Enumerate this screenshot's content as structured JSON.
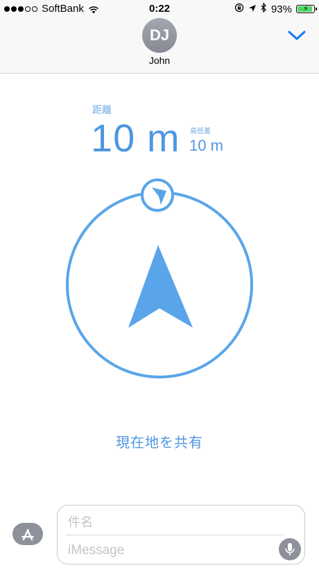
{
  "status_bar": {
    "carrier": "SoftBank",
    "signal_bars_filled": 3,
    "signal_bars_total": 5,
    "time": "0:22",
    "battery_percent": "93%",
    "battery_level": 0.93,
    "icons": [
      "wifi-icon",
      "rotation-lock-icon",
      "location-arrow-icon",
      "bluetooth-icon",
      "battery-icon",
      "charging-bolt-icon"
    ]
  },
  "header": {
    "avatar_initials": "DJ",
    "contact_name": "John",
    "collapse_icon": "chevron-down-icon"
  },
  "location": {
    "distance_label": "距離",
    "distance_value": "10 m",
    "altitude_label": "高低差",
    "altitude_value": "10 m",
    "share_button_label": "現在地を共有"
  },
  "input_bar": {
    "appstore_icon": "app-store-icon",
    "subject_placeholder": "件名",
    "message_placeholder": "iMessage",
    "mic_icon": "microphone-icon"
  },
  "colors": {
    "accent": "#4f97e0",
    "compass_fill": "#5aa5ea",
    "ios_blue": "#1a7cf5"
  }
}
